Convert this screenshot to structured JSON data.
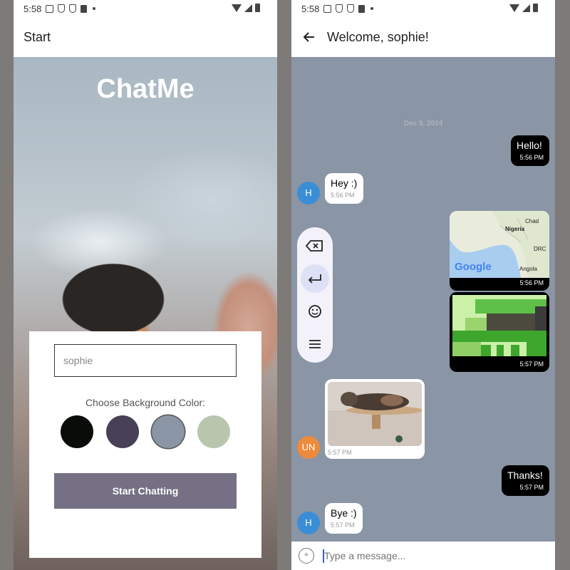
{
  "status": {
    "time": "5:58"
  },
  "start": {
    "title": "Start",
    "logo": "ChatMe",
    "name_value": "sophie",
    "color_label": "Choose Background Color:",
    "swatches": [
      "#090C08",
      "#474056",
      "#8A95A5",
      "#B9C6AE"
    ],
    "start_button": "Start Chatting"
  },
  "chat": {
    "title": "Welcome, sophie!",
    "date": "Dec 9, 2024",
    "messages": [
      {
        "side": "right",
        "text": "Hello!",
        "time": "5:56 PM"
      },
      {
        "side": "left",
        "avatar": "H",
        "text": "Hey :)",
        "time": "5:56 PM"
      },
      {
        "side": "right",
        "type": "map",
        "time": "5:56 PM",
        "labels": [
          "Chad",
          "Nigeria",
          "DRC",
          "Angola"
        ],
        "brand": "Google"
      },
      {
        "side": "right",
        "type": "image",
        "time": "5:57 PM"
      },
      {
        "side": "left",
        "avatar": "UN",
        "type": "image",
        "time": "5:57 PM"
      },
      {
        "side": "right",
        "text": "Thanks!",
        "time": "5:57 PM"
      },
      {
        "side": "left",
        "avatar": "H",
        "text": "Bye :)",
        "time": "5:57 PM"
      }
    ],
    "input_placeholder": "Type a message...",
    "attach_symbol": "+"
  },
  "colors": {
    "user_bubble": "#000000",
    "other_bubble": "#ffffff",
    "avatar_h": "#3b8ed6",
    "avatar_un": "#ee8a3c",
    "chat_bg": "#8A95A5"
  }
}
